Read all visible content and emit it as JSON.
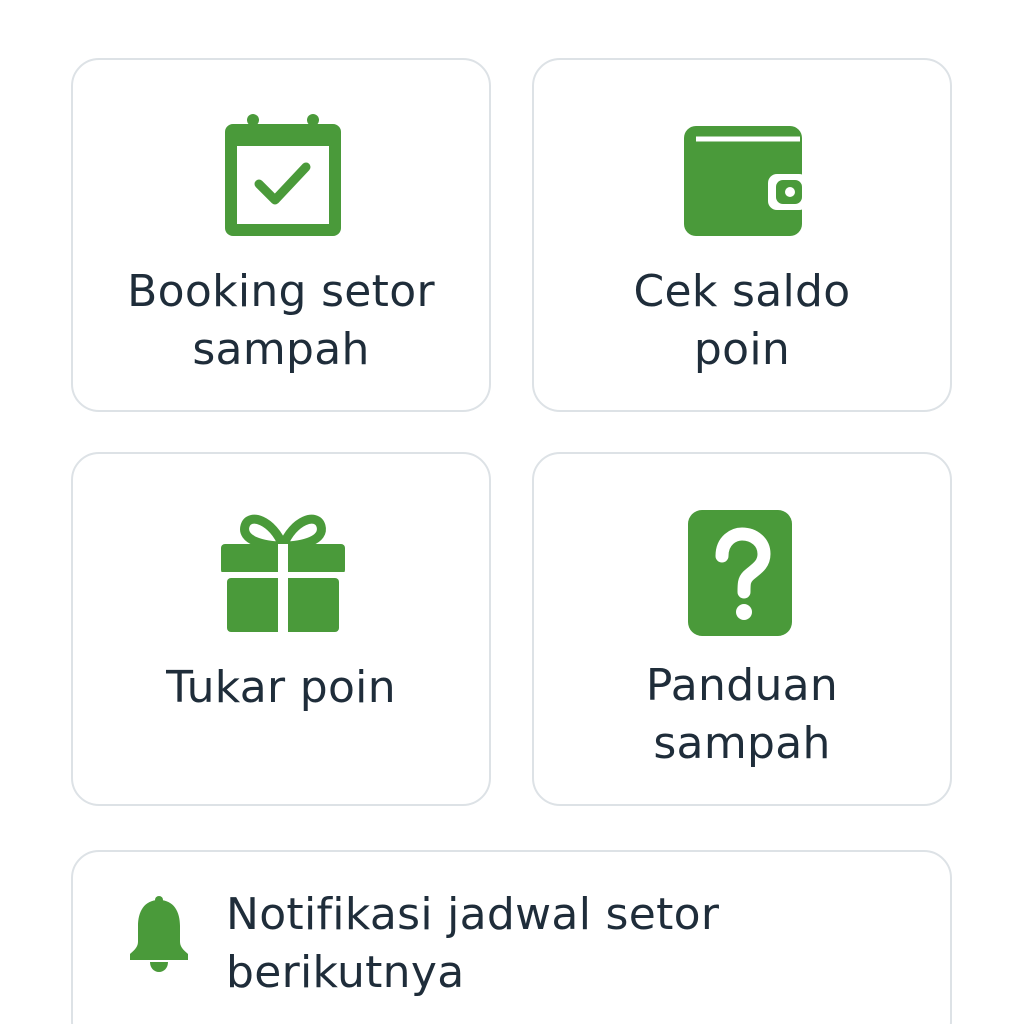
{
  "colors": {
    "accent_green": "#4a9a3a",
    "text": "#1f2d3a",
    "card_border": "#dde2e6",
    "background": "#ffffff"
  },
  "menu": {
    "booking": {
      "icon": "calendar-check-icon",
      "line1": "Booking setor",
      "line2": "sampah"
    },
    "saldo": {
      "icon": "wallet-icon",
      "line1": "Cek saldo",
      "line2": "poin"
    },
    "tukar": {
      "icon": "gift-icon",
      "line1": "Tukar poin"
    },
    "panduan": {
      "icon": "question-icon",
      "line1": "Panduan",
      "line2": "sampah"
    }
  },
  "notification": {
    "icon": "bell-icon",
    "line1": "Notifikasi jadwal setor",
    "line2": "berikutnya"
  }
}
